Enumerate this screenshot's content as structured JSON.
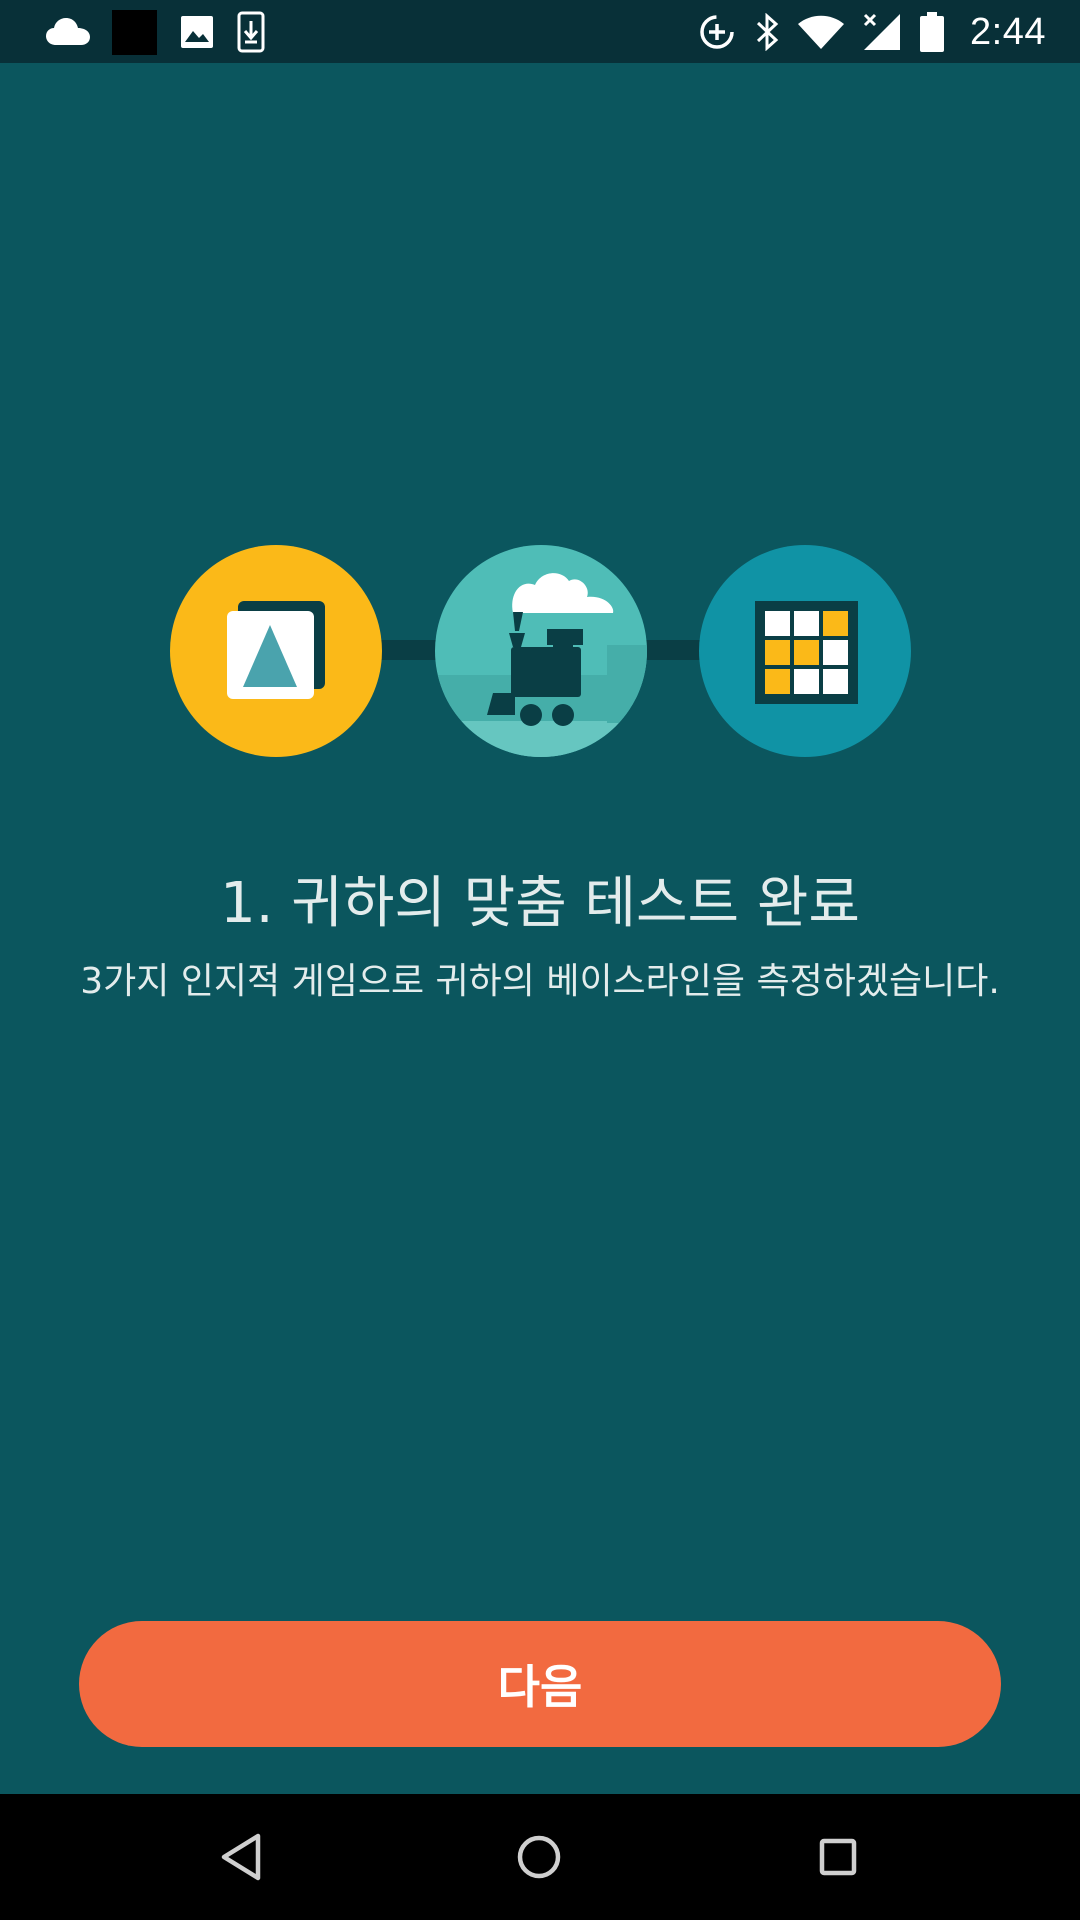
{
  "status_bar": {
    "time": "2:44",
    "left_icons": [
      "cloud-icon",
      "black-square-icon",
      "image-icon",
      "download-icon"
    ],
    "right_icons": [
      "data-saver-icon",
      "bluetooth-icon",
      "wifi-icon",
      "signal-icon",
      "battery-icon"
    ]
  },
  "illustration": {
    "games": [
      {
        "icon": "triangle-card-icon",
        "color": "#fbb918"
      },
      {
        "icon": "train-icon",
        "color": "#4fbdb7"
      },
      {
        "icon": "grid-icon",
        "color": "#1093a5"
      }
    ]
  },
  "content": {
    "title": "1. 귀하의 맞춤 테스트 완료",
    "description": "3가지 인지적 게임으로 귀하의 베이스라인을 측정하겠습니다."
  },
  "actions": {
    "next_label": "다음",
    "next_color": "#f26a40"
  },
  "nav_bar": {
    "buttons": [
      "back-icon",
      "home-icon",
      "recents-icon"
    ]
  }
}
